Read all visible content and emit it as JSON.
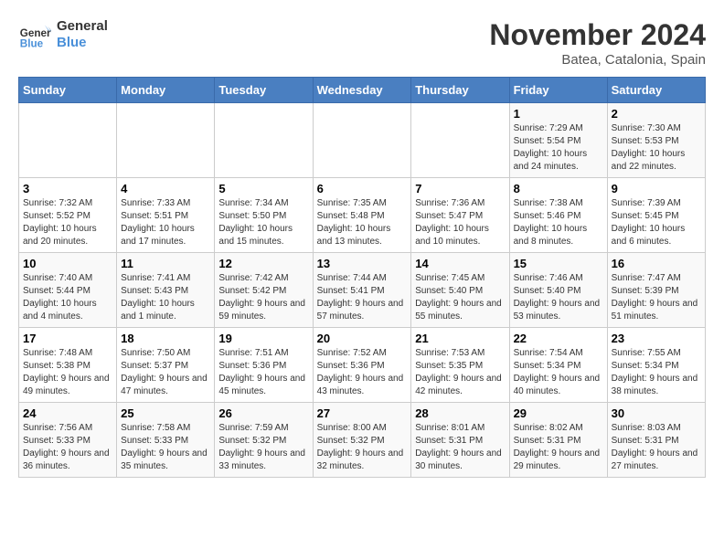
{
  "logo": {
    "line1": "General",
    "line2": "Blue"
  },
  "title": "November 2024",
  "subtitle": "Batea, Catalonia, Spain",
  "headers": [
    "Sunday",
    "Monday",
    "Tuesday",
    "Wednesday",
    "Thursday",
    "Friday",
    "Saturday"
  ],
  "weeks": [
    [
      {
        "day": "",
        "info": ""
      },
      {
        "day": "",
        "info": ""
      },
      {
        "day": "",
        "info": ""
      },
      {
        "day": "",
        "info": ""
      },
      {
        "day": "",
        "info": ""
      },
      {
        "day": "1",
        "info": "Sunrise: 7:29 AM\nSunset: 5:54 PM\nDaylight: 10 hours and 24 minutes."
      },
      {
        "day": "2",
        "info": "Sunrise: 7:30 AM\nSunset: 5:53 PM\nDaylight: 10 hours and 22 minutes."
      }
    ],
    [
      {
        "day": "3",
        "info": "Sunrise: 7:32 AM\nSunset: 5:52 PM\nDaylight: 10 hours and 20 minutes."
      },
      {
        "day": "4",
        "info": "Sunrise: 7:33 AM\nSunset: 5:51 PM\nDaylight: 10 hours and 17 minutes."
      },
      {
        "day": "5",
        "info": "Sunrise: 7:34 AM\nSunset: 5:50 PM\nDaylight: 10 hours and 15 minutes."
      },
      {
        "day": "6",
        "info": "Sunrise: 7:35 AM\nSunset: 5:48 PM\nDaylight: 10 hours and 13 minutes."
      },
      {
        "day": "7",
        "info": "Sunrise: 7:36 AM\nSunset: 5:47 PM\nDaylight: 10 hours and 10 minutes."
      },
      {
        "day": "8",
        "info": "Sunrise: 7:38 AM\nSunset: 5:46 PM\nDaylight: 10 hours and 8 minutes."
      },
      {
        "day": "9",
        "info": "Sunrise: 7:39 AM\nSunset: 5:45 PM\nDaylight: 10 hours and 6 minutes."
      }
    ],
    [
      {
        "day": "10",
        "info": "Sunrise: 7:40 AM\nSunset: 5:44 PM\nDaylight: 10 hours and 4 minutes."
      },
      {
        "day": "11",
        "info": "Sunrise: 7:41 AM\nSunset: 5:43 PM\nDaylight: 10 hours and 1 minute."
      },
      {
        "day": "12",
        "info": "Sunrise: 7:42 AM\nSunset: 5:42 PM\nDaylight: 9 hours and 59 minutes."
      },
      {
        "day": "13",
        "info": "Sunrise: 7:44 AM\nSunset: 5:41 PM\nDaylight: 9 hours and 57 minutes."
      },
      {
        "day": "14",
        "info": "Sunrise: 7:45 AM\nSunset: 5:40 PM\nDaylight: 9 hours and 55 minutes."
      },
      {
        "day": "15",
        "info": "Sunrise: 7:46 AM\nSunset: 5:40 PM\nDaylight: 9 hours and 53 minutes."
      },
      {
        "day": "16",
        "info": "Sunrise: 7:47 AM\nSunset: 5:39 PM\nDaylight: 9 hours and 51 minutes."
      }
    ],
    [
      {
        "day": "17",
        "info": "Sunrise: 7:48 AM\nSunset: 5:38 PM\nDaylight: 9 hours and 49 minutes."
      },
      {
        "day": "18",
        "info": "Sunrise: 7:50 AM\nSunset: 5:37 PM\nDaylight: 9 hours and 47 minutes."
      },
      {
        "day": "19",
        "info": "Sunrise: 7:51 AM\nSunset: 5:36 PM\nDaylight: 9 hours and 45 minutes."
      },
      {
        "day": "20",
        "info": "Sunrise: 7:52 AM\nSunset: 5:36 PM\nDaylight: 9 hours and 43 minutes."
      },
      {
        "day": "21",
        "info": "Sunrise: 7:53 AM\nSunset: 5:35 PM\nDaylight: 9 hours and 42 minutes."
      },
      {
        "day": "22",
        "info": "Sunrise: 7:54 AM\nSunset: 5:34 PM\nDaylight: 9 hours and 40 minutes."
      },
      {
        "day": "23",
        "info": "Sunrise: 7:55 AM\nSunset: 5:34 PM\nDaylight: 9 hours and 38 minutes."
      }
    ],
    [
      {
        "day": "24",
        "info": "Sunrise: 7:56 AM\nSunset: 5:33 PM\nDaylight: 9 hours and 36 minutes."
      },
      {
        "day": "25",
        "info": "Sunrise: 7:58 AM\nSunset: 5:33 PM\nDaylight: 9 hours and 35 minutes."
      },
      {
        "day": "26",
        "info": "Sunrise: 7:59 AM\nSunset: 5:32 PM\nDaylight: 9 hours and 33 minutes."
      },
      {
        "day": "27",
        "info": "Sunrise: 8:00 AM\nSunset: 5:32 PM\nDaylight: 9 hours and 32 minutes."
      },
      {
        "day": "28",
        "info": "Sunrise: 8:01 AM\nSunset: 5:31 PM\nDaylight: 9 hours and 30 minutes."
      },
      {
        "day": "29",
        "info": "Sunrise: 8:02 AM\nSunset: 5:31 PM\nDaylight: 9 hours and 29 minutes."
      },
      {
        "day": "30",
        "info": "Sunrise: 8:03 AM\nSunset: 5:31 PM\nDaylight: 9 hours and 27 minutes."
      }
    ]
  ]
}
